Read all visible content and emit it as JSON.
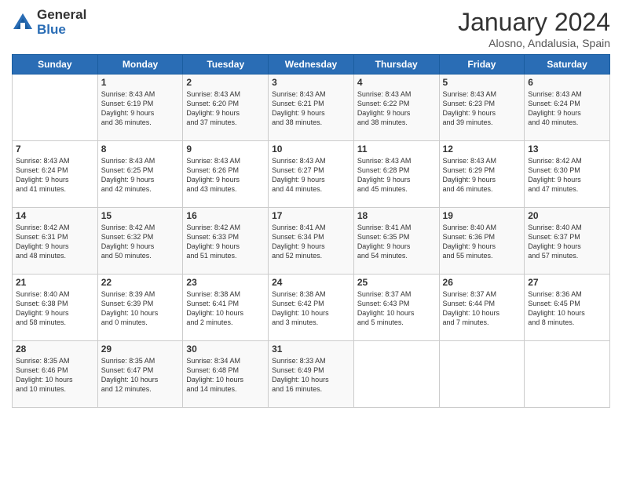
{
  "header": {
    "logo_general": "General",
    "logo_blue": "Blue",
    "month_title": "January 2024",
    "location": "Alosno, Andalusia, Spain"
  },
  "days_of_week": [
    "Sunday",
    "Monday",
    "Tuesday",
    "Wednesday",
    "Thursday",
    "Friday",
    "Saturday"
  ],
  "weeks": [
    [
      {
        "day": "",
        "info": ""
      },
      {
        "day": "1",
        "info": "Sunrise: 8:43 AM\nSunset: 6:19 PM\nDaylight: 9 hours\nand 36 minutes."
      },
      {
        "day": "2",
        "info": "Sunrise: 8:43 AM\nSunset: 6:20 PM\nDaylight: 9 hours\nand 37 minutes."
      },
      {
        "day": "3",
        "info": "Sunrise: 8:43 AM\nSunset: 6:21 PM\nDaylight: 9 hours\nand 38 minutes."
      },
      {
        "day": "4",
        "info": "Sunrise: 8:43 AM\nSunset: 6:22 PM\nDaylight: 9 hours\nand 38 minutes."
      },
      {
        "day": "5",
        "info": "Sunrise: 8:43 AM\nSunset: 6:23 PM\nDaylight: 9 hours\nand 39 minutes."
      },
      {
        "day": "6",
        "info": "Sunrise: 8:43 AM\nSunset: 6:24 PM\nDaylight: 9 hours\nand 40 minutes."
      }
    ],
    [
      {
        "day": "7",
        "info": "Sunrise: 8:43 AM\nSunset: 6:24 PM\nDaylight: 9 hours\nand 41 minutes."
      },
      {
        "day": "8",
        "info": "Sunrise: 8:43 AM\nSunset: 6:25 PM\nDaylight: 9 hours\nand 42 minutes."
      },
      {
        "day": "9",
        "info": "Sunrise: 8:43 AM\nSunset: 6:26 PM\nDaylight: 9 hours\nand 43 minutes."
      },
      {
        "day": "10",
        "info": "Sunrise: 8:43 AM\nSunset: 6:27 PM\nDaylight: 9 hours\nand 44 minutes."
      },
      {
        "day": "11",
        "info": "Sunrise: 8:43 AM\nSunset: 6:28 PM\nDaylight: 9 hours\nand 45 minutes."
      },
      {
        "day": "12",
        "info": "Sunrise: 8:43 AM\nSunset: 6:29 PM\nDaylight: 9 hours\nand 46 minutes."
      },
      {
        "day": "13",
        "info": "Sunrise: 8:42 AM\nSunset: 6:30 PM\nDaylight: 9 hours\nand 47 minutes."
      }
    ],
    [
      {
        "day": "14",
        "info": "Sunrise: 8:42 AM\nSunset: 6:31 PM\nDaylight: 9 hours\nand 48 minutes."
      },
      {
        "day": "15",
        "info": "Sunrise: 8:42 AM\nSunset: 6:32 PM\nDaylight: 9 hours\nand 50 minutes."
      },
      {
        "day": "16",
        "info": "Sunrise: 8:42 AM\nSunset: 6:33 PM\nDaylight: 9 hours\nand 51 minutes."
      },
      {
        "day": "17",
        "info": "Sunrise: 8:41 AM\nSunset: 6:34 PM\nDaylight: 9 hours\nand 52 minutes."
      },
      {
        "day": "18",
        "info": "Sunrise: 8:41 AM\nSunset: 6:35 PM\nDaylight: 9 hours\nand 54 minutes."
      },
      {
        "day": "19",
        "info": "Sunrise: 8:40 AM\nSunset: 6:36 PM\nDaylight: 9 hours\nand 55 minutes."
      },
      {
        "day": "20",
        "info": "Sunrise: 8:40 AM\nSunset: 6:37 PM\nDaylight: 9 hours\nand 57 minutes."
      }
    ],
    [
      {
        "day": "21",
        "info": "Sunrise: 8:40 AM\nSunset: 6:38 PM\nDaylight: 9 hours\nand 58 minutes."
      },
      {
        "day": "22",
        "info": "Sunrise: 8:39 AM\nSunset: 6:39 PM\nDaylight: 10 hours\nand 0 minutes."
      },
      {
        "day": "23",
        "info": "Sunrise: 8:38 AM\nSunset: 6:41 PM\nDaylight: 10 hours\nand 2 minutes."
      },
      {
        "day": "24",
        "info": "Sunrise: 8:38 AM\nSunset: 6:42 PM\nDaylight: 10 hours\nand 3 minutes."
      },
      {
        "day": "25",
        "info": "Sunrise: 8:37 AM\nSunset: 6:43 PM\nDaylight: 10 hours\nand 5 minutes."
      },
      {
        "day": "26",
        "info": "Sunrise: 8:37 AM\nSunset: 6:44 PM\nDaylight: 10 hours\nand 7 minutes."
      },
      {
        "day": "27",
        "info": "Sunrise: 8:36 AM\nSunset: 6:45 PM\nDaylight: 10 hours\nand 8 minutes."
      }
    ],
    [
      {
        "day": "28",
        "info": "Sunrise: 8:35 AM\nSunset: 6:46 PM\nDaylight: 10 hours\nand 10 minutes."
      },
      {
        "day": "29",
        "info": "Sunrise: 8:35 AM\nSunset: 6:47 PM\nDaylight: 10 hours\nand 12 minutes."
      },
      {
        "day": "30",
        "info": "Sunrise: 8:34 AM\nSunset: 6:48 PM\nDaylight: 10 hours\nand 14 minutes."
      },
      {
        "day": "31",
        "info": "Sunrise: 8:33 AM\nSunset: 6:49 PM\nDaylight: 10 hours\nand 16 minutes."
      },
      {
        "day": "",
        "info": ""
      },
      {
        "day": "",
        "info": ""
      },
      {
        "day": "",
        "info": ""
      }
    ]
  ]
}
